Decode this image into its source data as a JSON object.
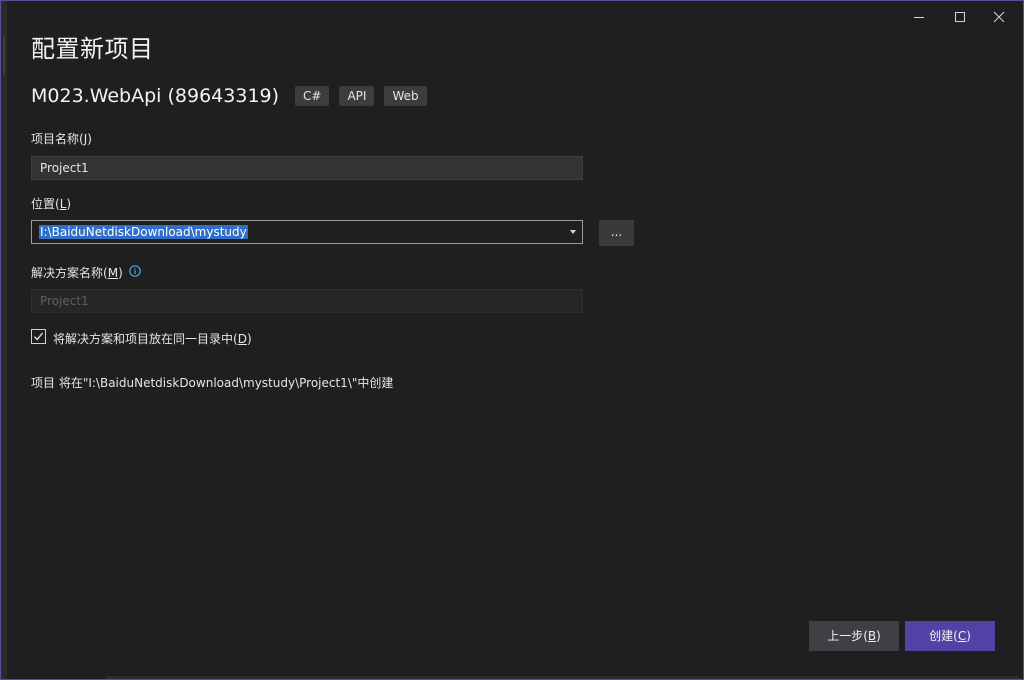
{
  "window": {
    "controls": {
      "minimize": "minimize",
      "maximize": "maximize",
      "close": "close"
    }
  },
  "header": {
    "title": "配置新项目",
    "template_name": "M023.WebApi (89643319)",
    "tags": [
      "C#",
      "API",
      "Web"
    ]
  },
  "form": {
    "project_name": {
      "label": "项目名称",
      "mnemonic": "J",
      "value": "Project1"
    },
    "location": {
      "label": "位置",
      "mnemonic": "L",
      "value": "I:\\BaiduNetdiskDownload\\mystudy"
    },
    "browse_label": "...",
    "solution_name": {
      "label": "解决方案名称",
      "mnemonic": "M",
      "value": "Project1"
    },
    "same_dir": {
      "label": "将解决方案和项目放在同一目录中",
      "mnemonic": "D",
      "checked": true
    },
    "path_info": "项目 将在\"I:\\BaiduNetdiskDownload\\mystudy\\Project1\\\"中创建"
  },
  "footer": {
    "back": {
      "label": "上一步",
      "mnemonic": "B"
    },
    "create": {
      "label": "创建",
      "mnemonic": "C"
    }
  },
  "colors": {
    "accent": "#5441a6",
    "selection": "#2f6fc9"
  }
}
